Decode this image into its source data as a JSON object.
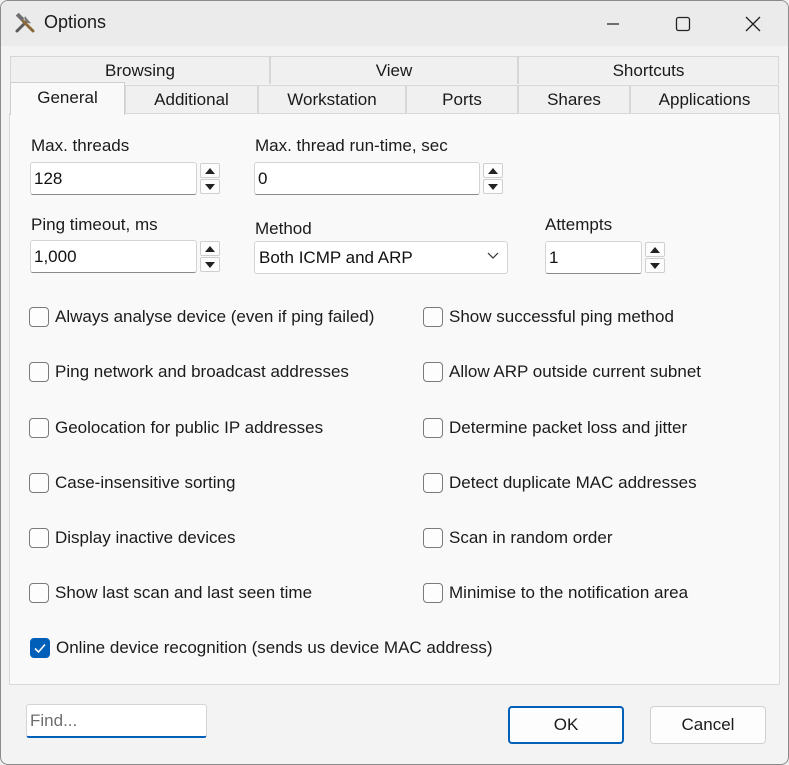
{
  "window": {
    "title": "Options"
  },
  "tabs_top": [
    "Browsing",
    "View",
    "Shortcuts"
  ],
  "tabs_bottom": [
    "General",
    "Additional",
    "Workstation",
    "Ports",
    "Shares",
    "Applications"
  ],
  "active_tab": "General",
  "fields": {
    "max_threads": {
      "label": "Max. threads",
      "value": "128"
    },
    "max_runtime": {
      "label": "Max. thread run-time, sec",
      "value": "0"
    },
    "ping_timeout": {
      "label": "Ping timeout, ms",
      "value": "1,000"
    },
    "method": {
      "label": "Method",
      "value": "Both ICMP and ARP"
    },
    "attempts": {
      "label": "Attempts",
      "value": "1"
    }
  },
  "checkboxes_left": [
    {
      "label": "Always analyse device (even if ping failed)",
      "checked": false
    },
    {
      "label": "Ping network and broadcast addresses",
      "checked": false
    },
    {
      "label": "Geolocation for public IP addresses",
      "checked": false
    },
    {
      "label": "Case-insensitive sorting",
      "checked": false
    },
    {
      "label": "Display inactive devices",
      "checked": false
    },
    {
      "label": "Show last scan and last seen time",
      "checked": false
    }
  ],
  "checkboxes_right": [
    {
      "label": "Show successful ping method",
      "checked": false
    },
    {
      "label": "Allow ARP outside current subnet",
      "checked": false
    },
    {
      "label": "Determine packet loss and jitter",
      "checked": false
    },
    {
      "label": "Detect duplicate MAC addresses",
      "checked": false
    },
    {
      "label": "Scan in random order",
      "checked": false
    },
    {
      "label": "Minimise to the notification area",
      "checked": false
    }
  ],
  "online_recognition": {
    "label": "Online device recognition (sends us device MAC address)",
    "checked": true
  },
  "footer": {
    "find_placeholder": "Find...",
    "ok_label": "OK",
    "cancel_label": "Cancel"
  },
  "colors": {
    "accent": "#005fb8"
  }
}
